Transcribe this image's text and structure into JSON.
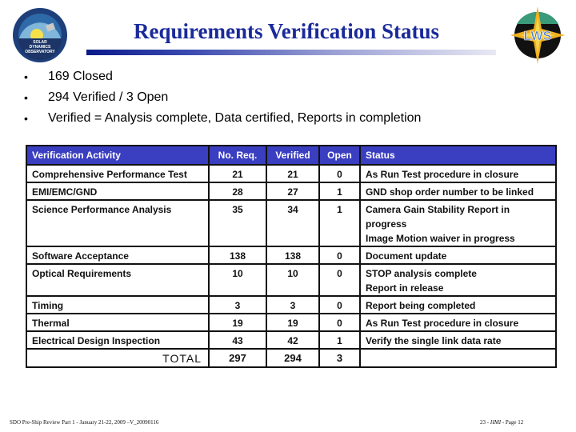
{
  "header": {
    "title": "Requirements Verification Status",
    "left_logo": "sdo-logo-icon",
    "right_logo": "lws-logo-icon",
    "left_logo_text": [
      "SOLAR",
      "DYNAMICS",
      "OBSERVATORY"
    ],
    "right_logo_text": "LWS"
  },
  "bullets": [
    {
      "text": "169 Closed"
    },
    {
      "text": "294 Verified /  3 Open"
    },
    {
      "text": "Verified = Analysis complete, Data certified, Reports in completion"
    }
  ],
  "table": {
    "columns": [
      "Verification Activity",
      "No. Req.",
      "Verified",
      "Open",
      "Status"
    ],
    "rows": [
      {
        "activity": "Comprehensive Performance Test",
        "req": "21",
        "verified": "21",
        "open": "0",
        "status": [
          "As Run Test procedure in closure"
        ]
      },
      {
        "activity": "EMI/EMC/GND",
        "req": "28",
        "verified": "27",
        "open": "1",
        "status": [
          "GND shop order number to be linked"
        ]
      },
      {
        "activity": "Science Performance Analysis",
        "req": "35",
        "verified": "34",
        "open": "1",
        "status": [
          "Camera Gain Stability Report in progress",
          "Image Motion waiver in progress"
        ]
      },
      {
        "activity": "Software Acceptance",
        "req": "138",
        "verified": "138",
        "open": "0",
        "status": [
          "Document update"
        ]
      },
      {
        "activity": "Optical Requirements",
        "req": "10",
        "verified": "10",
        "open": "0",
        "status": [
          "STOP analysis complete",
          "Report in release"
        ]
      },
      {
        "activity": "Timing",
        "req": "3",
        "verified": "3",
        "open": "0",
        "status": [
          "Report being completed"
        ]
      },
      {
        "activity": "Thermal",
        "req": "19",
        "verified": "19",
        "open": "0",
        "status": [
          "As Run Test procedure in closure"
        ]
      },
      {
        "activity": "Electrical Design Inspection",
        "req": "43",
        "verified": "42",
        "open": "1",
        "status": [
          "Verify the single link data rate"
        ]
      }
    ],
    "total": {
      "label": "TOTAL",
      "req": "297",
      "verified": "294",
      "open": "3"
    }
  },
  "footer": {
    "left": "SDO Pre-Ship Review Part 1 - January 21-22, 2009 –V_20090116",
    "right_prefix": "23 - ",
    "right_italic": "HMI",
    "right_suffix": " - Page 12"
  },
  "colors": {
    "title": "#1a2a9a",
    "table_header_bg": "#3a3ec0",
    "table_header_text": "#ffffff"
  }
}
